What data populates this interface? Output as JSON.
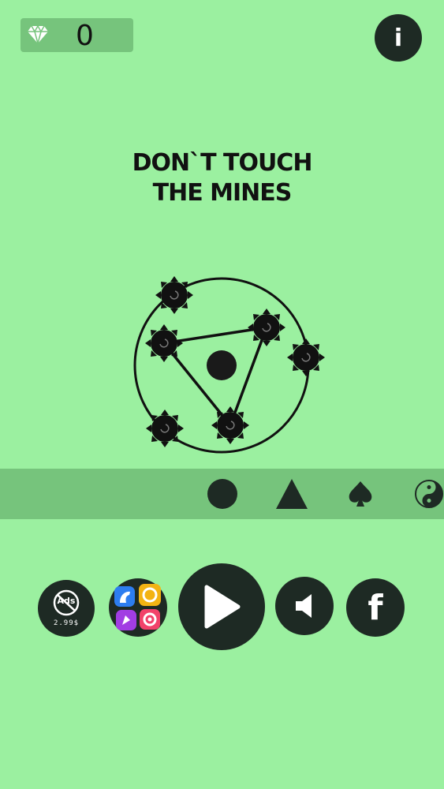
{
  "hud": {
    "gem_count": "0",
    "info_label": "i"
  },
  "title": {
    "line1": "DON`T TOUCH",
    "line2": "THE MINES"
  },
  "shapes": [
    "circle-icon",
    "triangle-icon",
    "spade-icon",
    "yin-yang-icon"
  ],
  "buttons": {
    "no_ads_label": "Ads",
    "no_ads_price": "2.99$",
    "facebook_label": "f"
  },
  "colors": {
    "background": "#9bf0a0",
    "panel": "#76c47c",
    "dark": "#1e2a24"
  }
}
